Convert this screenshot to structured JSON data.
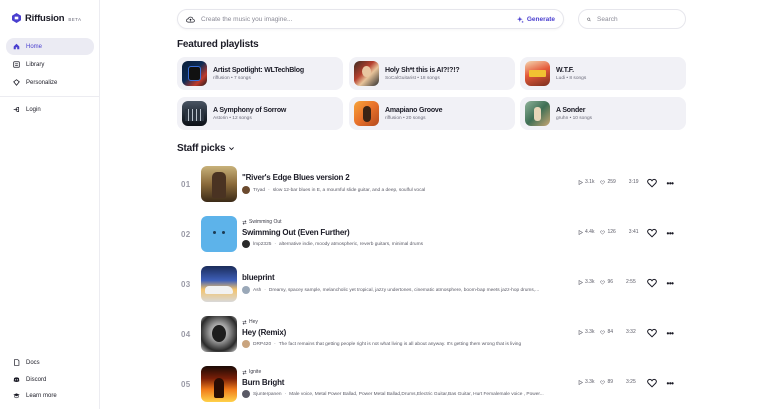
{
  "brand": {
    "name": "Riffusion",
    "badge": "BETA",
    "color": "#4a3fcf"
  },
  "sidebar": {
    "items": [
      {
        "label": "Home",
        "icon": "home-icon",
        "active": true
      },
      {
        "label": "Library",
        "icon": "library-icon",
        "active": false
      },
      {
        "label": "Personalize",
        "icon": "personalize-icon",
        "active": false
      },
      {
        "label": "Login",
        "icon": "login-icon",
        "active": false
      }
    ],
    "footer": [
      {
        "label": "Docs",
        "icon": "docs-icon"
      },
      {
        "label": "Discord",
        "icon": "discord-icon"
      },
      {
        "label": "Learn more",
        "icon": "graduation-cap-icon"
      }
    ]
  },
  "create": {
    "placeholder": "Create the music you imagine...",
    "generate_label": "Generate"
  },
  "search": {
    "placeholder": "Search"
  },
  "featured": {
    "title": "Featured playlists",
    "playlists": [
      {
        "title": "Artist Spotlight: WLTechBlog",
        "subtitle": "riffusion • 7 songs"
      },
      {
        "title": "Holy Sh*t this is AI?!?!?",
        "subtitle": "SoCalGuitarist • 18 songs"
      },
      {
        "title": "W.T.F.",
        "subtitle": "Ludi • 8 songs"
      },
      {
        "title": "A Symphony of Sorrow",
        "subtitle": "Astorin • 12 songs"
      },
      {
        "title": "Amapiano Groove",
        "subtitle": "riffusion • 20 songs"
      },
      {
        "title": "A Sonder",
        "subtitle": "gruhn • 10 songs"
      }
    ]
  },
  "staff": {
    "title": "Staff picks",
    "tracks": [
      {
        "num": "01",
        "pre": "",
        "title": "\"River's Edge Blues version 2",
        "author": "Tryad",
        "desc": "slow 12-bar blues in E, a mournful slide guitar, and a deep, soulful vocal",
        "plays": "3.1k",
        "likes": "259",
        "duration": "3:19"
      },
      {
        "num": "02",
        "pre": "Swimming Out",
        "title": "Swimming Out (Even Further)",
        "author": "lmp2325",
        "desc": "alternative indie, moody atmospheric, reverb guitars, minimal drums",
        "plays": "4.4k",
        "likes": "126",
        "duration": "3:41"
      },
      {
        "num": "03",
        "pre": "",
        "title": "blueprint",
        "author": "Ash",
        "desc": "Dreamy, spacey sample, melancholic yet tropical, jazzy undertones, cinematic atmosphere, boom-bap meets jazz-hop drums,...",
        "plays": "3.3k",
        "likes": "96",
        "duration": "2:55"
      },
      {
        "num": "04",
        "pre": "Hey",
        "title": "Hey (Remix)",
        "author": "DRP420",
        "desc": "The fact remains that getting people right is not what living is all about anyway. It's getting them wrong that is living",
        "plays": "3.3k",
        "likes": "84",
        "duration": "3:32"
      },
      {
        "num": "05",
        "pre": "Ignite",
        "title": "Burn Bright",
        "author": "Sjunterpanen",
        "desc": "Male voice, Metal Power Ballad, Power Metal Ballad,Drums,Electric Guitar,Bas Guitar, Hurt Femalemale voice , Power...",
        "plays": "3.3k",
        "likes": "89",
        "duration": "3:25"
      }
    ]
  }
}
